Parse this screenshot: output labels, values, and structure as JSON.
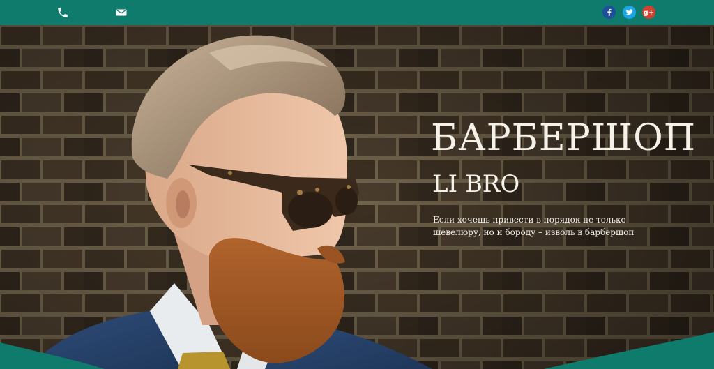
{
  "topbar": {
    "phone_icon": "phone-icon",
    "mail_icon": "mail-icon",
    "social": [
      {
        "name": "facebook",
        "glyph": "f",
        "color": "#1e4f9a"
      },
      {
        "name": "twitter",
        "glyph": "t",
        "color": "#1ca6e6"
      },
      {
        "name": "google-plus",
        "glyph": "g+",
        "color": "#d0422f"
      }
    ],
    "color": "#0f7b6c"
  },
  "hero": {
    "title": "БАРБЕРШОП",
    "subtitle": "LI BRO",
    "text": "Если хочешь привести в порядок не только шевелюру, но и бороду – изволь в барбершоп"
  },
  "colors": {
    "accent": "#0f7b6c"
  }
}
